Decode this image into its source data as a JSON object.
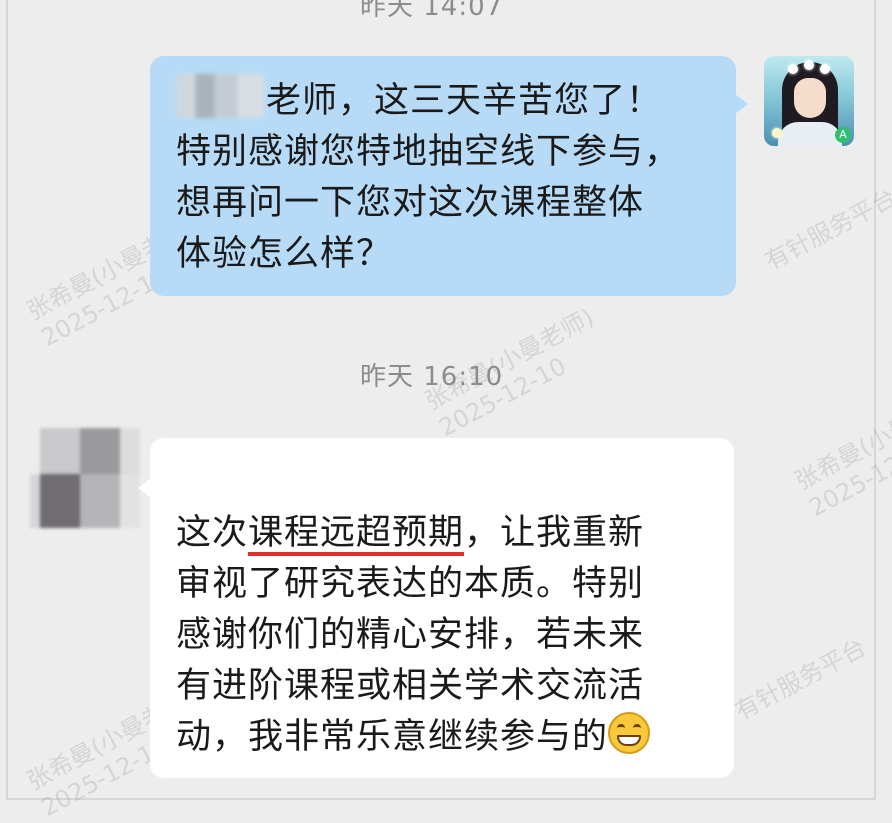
{
  "timestamps": {
    "top": "昨天 14:07",
    "middle": "昨天 16:10"
  },
  "watermark": {
    "name": "张希曼(小曼老师)",
    "date": "2025-12-10",
    "platform": "有针服务平台"
  },
  "messages": [
    {
      "direction": "outgoing",
      "lines": [
        "老师，这三天辛苦您了！",
        "特别感谢您特地抽空线下参与，",
        "想再问一下您对这次课程整体",
        "体验怎么样？"
      ]
    },
    {
      "direction": "incoming",
      "lines": [
        "这次课程远超预期，让我重新",
        "审视了研究表达的本质。特别",
        "感谢你们的精心安排，若未来",
        "有进阶课程或相关学术交流活",
        "动，我非常乐意继续参与的"
      ],
      "underlined": "课程远超预期",
      "emoji": "grinning-face"
    }
  ],
  "colors": {
    "background": "#ededed",
    "outgoing_bubble": "#b7dbf7",
    "incoming_bubble": "#ffffff",
    "underline": "#e0302b",
    "timestamp": "#8c8c8c"
  }
}
